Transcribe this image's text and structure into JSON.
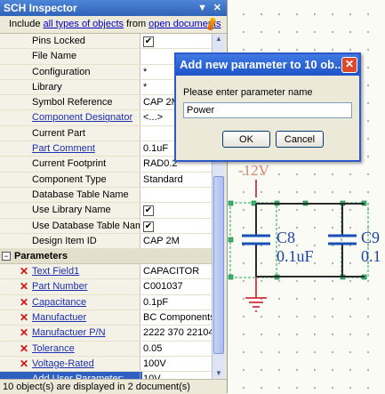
{
  "inspector": {
    "title": "SCH Inspector",
    "dropdown_glyph": "▼",
    "close_glyph": "✕",
    "include_prefix": "Include",
    "include_link1": "all types of objects",
    "include_mid": "from",
    "include_link2": "open documents",
    "properties": [
      {
        "name": "Pins Locked",
        "value": "",
        "checkbox": true,
        "link": false
      },
      {
        "name": "File Name",
        "value": "",
        "link": false
      },
      {
        "name": "Configuration",
        "value": "*",
        "link": false
      },
      {
        "name": "Library",
        "value": "*",
        "link": false
      },
      {
        "name": "Symbol Reference",
        "value": "CAP 2M",
        "link": false
      },
      {
        "name": "Component Designator",
        "value": "<...>",
        "link": true
      },
      {
        "name": "Current Part",
        "value": "",
        "link": false
      },
      {
        "name": "Part Comment",
        "value": "0.1uF",
        "link": true
      },
      {
        "name": "Current Footprint",
        "value": "RAD0.2",
        "link": false
      },
      {
        "name": "Component Type",
        "value": "Standard",
        "link": false
      },
      {
        "name": "Database Table Name",
        "value": "",
        "link": false
      },
      {
        "name": "Use Library Name",
        "value": "",
        "checkbox": true,
        "link": false
      },
      {
        "name": "Use Database Table Name",
        "value": "",
        "checkbox": true,
        "link": false
      },
      {
        "name": "Design Item ID",
        "value": "CAP 2M",
        "link": false
      }
    ],
    "parameters_header": "Parameters",
    "parameters": [
      {
        "name": "Text Field1",
        "value": "CAPACITOR"
      },
      {
        "name": "Part Number",
        "value": "C001037"
      },
      {
        "name": "Capacitance",
        "value": "0.1pF"
      },
      {
        "name": "Manufactuer",
        "value": "BC Components"
      },
      {
        "name": "Manufactuer P/N",
        "value": "2222 370 22104"
      },
      {
        "name": "Tolerance",
        "value": "0.05"
      },
      {
        "name": "Voltage-Rated",
        "value": "100V"
      }
    ],
    "add_row": {
      "name": "Add User Parameter:",
      "value": "10V"
    },
    "status": "10 object(s) are displayed in 2 document(s)"
  },
  "dialog": {
    "title": "Add new parameter to 10 ob...",
    "prompt": "Please enter parameter name",
    "input_value": "Power",
    "ok_label": "OK",
    "cancel_label": "Cancel"
  },
  "schematic": {
    "net_label": "-12V",
    "c8_designator": "C8",
    "c8_value": "0.1uF",
    "c9_designator": "C9",
    "c9_value": "0.1",
    "accent_color": "#c8101e",
    "selection_color": "#22a85a"
  }
}
